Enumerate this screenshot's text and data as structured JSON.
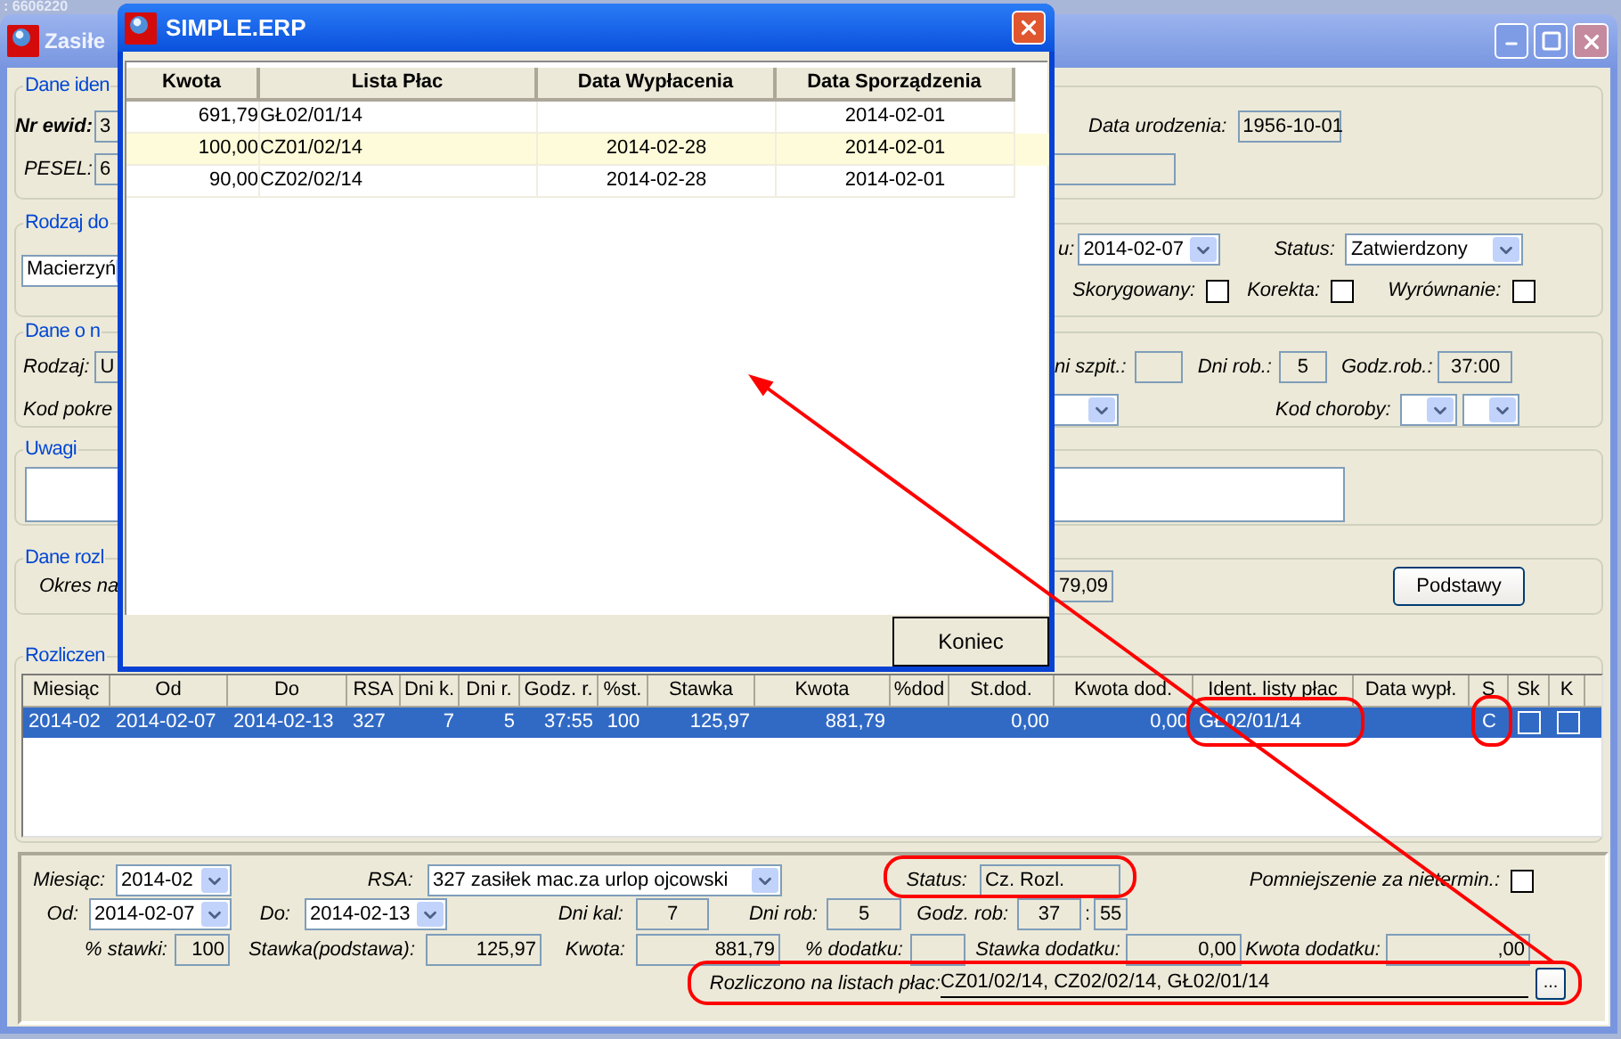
{
  "background_text": ": 6606220",
  "main_window": {
    "title": "Zasiłe",
    "identity": {
      "legend": "Dane iden",
      "nr_ewid_label": "Nr ewid:",
      "nr_ewid_value": "3",
      "pesel_label": "PESEL:",
      "pesel_value": "6",
      "birth_date_label": "Data urodzenia:",
      "birth_date_value": "1956-10-01"
    },
    "benefit_type": {
      "legend": "Rodzaj do",
      "type_value": "Macierzyń",
      "date_label": "u:",
      "date_value": "2014-02-07",
      "status_label": "Status:",
      "status_value": "Zatwierdzony",
      "flags": [
        {
          "label": "Skorygowany:",
          "checked": false
        },
        {
          "label": "Korekta:",
          "checked": false
        },
        {
          "label": "Wyrównanie:",
          "checked": false
        }
      ]
    },
    "absence": {
      "legend": "Dane o n",
      "kind_label": "Rodzaj:",
      "kind_value": "U",
      "code_label": "Kod pokre",
      "hospital_days_label": "ni szpit.:",
      "work_days_label": "Dni rob.:",
      "work_days_value": "5",
      "work_hours_label": "Godz.rob.:",
      "work_hours_value": "37:00",
      "disease_code_label": "Kod choroby:"
    },
    "notes": {
      "legend": "Uwagi"
    },
    "settlement_data": {
      "legend": "Dane rozl",
      "period_label": "Okres na",
      "amount_value": "79,09",
      "button": "Podstawy"
    },
    "settlements": {
      "legend": "Rozliczen",
      "columns": [
        "Miesiąc",
        "Od",
        "Do",
        "RSA",
        "Dni k.",
        "Dni r.",
        "Godz. r.",
        "%st.",
        "Stawka",
        "Kwota",
        "%dod",
        "St.dod.",
        "Kwota dod.",
        "Ident. listy płac",
        "Data wypł.",
        "S",
        "Sk",
        "K"
      ],
      "rows": [
        {
          "selected": true,
          "month": "2014-02",
          "from": "2014-02-07",
          "to": "2014-02-13",
          "rsa": "327",
          "cal_days": "7",
          "work_days": "5",
          "hours": "37:55",
          "rate_pct": "100",
          "rate": "125,97",
          "amount": "881,79",
          "extra_rate": "0,00",
          "extra_amount": "0,00",
          "payroll": "GŁ02/01/14",
          "status": "C",
          "sk_checked": false,
          "k_checked": false
        }
      ]
    },
    "details": {
      "month_label": "Miesiąc:",
      "month": "2014-02",
      "rsa_label": "RSA:",
      "rsa": "327 zasiłek mac.za urlop ojcowski",
      "status_label": "Status:",
      "status": "Cz. Rozl.",
      "reduction_label": "Pomniejszenie za nietermin.:",
      "reduction_checked": false,
      "from_label": "Od:",
      "from": "2014-02-07",
      "to_label": "Do:",
      "to": "2014-02-13",
      "cal_days_label": "Dni kal:",
      "cal_days": "7",
      "work_days_label": "Dni rob:",
      "work_days": "5",
      "hours_label": "Godz. rob:",
      "hours": "37",
      "time_separator": ":",
      "minutes": "55",
      "rate_pct_label": "% stawki:",
      "rate_pct": "100",
      "base_label": "Stawka(podstawa):",
      "base": "125,97",
      "amount_label": "Kwota:",
      "amount": "881,79",
      "extra_pct_label": "% dodatku:",
      "extra_rate_label": "Stawka dodatku:",
      "extra_rate": "0,00",
      "extra_amount_label": "Kwota dodatku:",
      "extra_amount": ",00",
      "settled_label": "Rozliczono na listach płac:",
      "settled_value": "CZ01/02/14, CZ02/02/14, GŁ02/01/14",
      "more_button": "..."
    }
  },
  "dialog": {
    "title": "SIMPLE.ERP",
    "columns": [
      "Kwota",
      "Lista Płac",
      "Data Wypłacenia",
      "Data Sporządzenia"
    ],
    "rows": [
      {
        "amount": "691,79",
        "payroll": "GŁ02/01/14",
        "created": "2014-02-01",
        "selected": false
      },
      {
        "amount": "100,00",
        "payroll": "CZ01/02/14",
        "paid": "2014-02-28",
        "created": "2014-02-01",
        "selected": true
      },
      {
        "amount": "90,00",
        "payroll": "CZ02/02/14",
        "paid": "2014-02-28",
        "created": "2014-02-01",
        "selected": false
      }
    ],
    "button": "Koniec"
  }
}
